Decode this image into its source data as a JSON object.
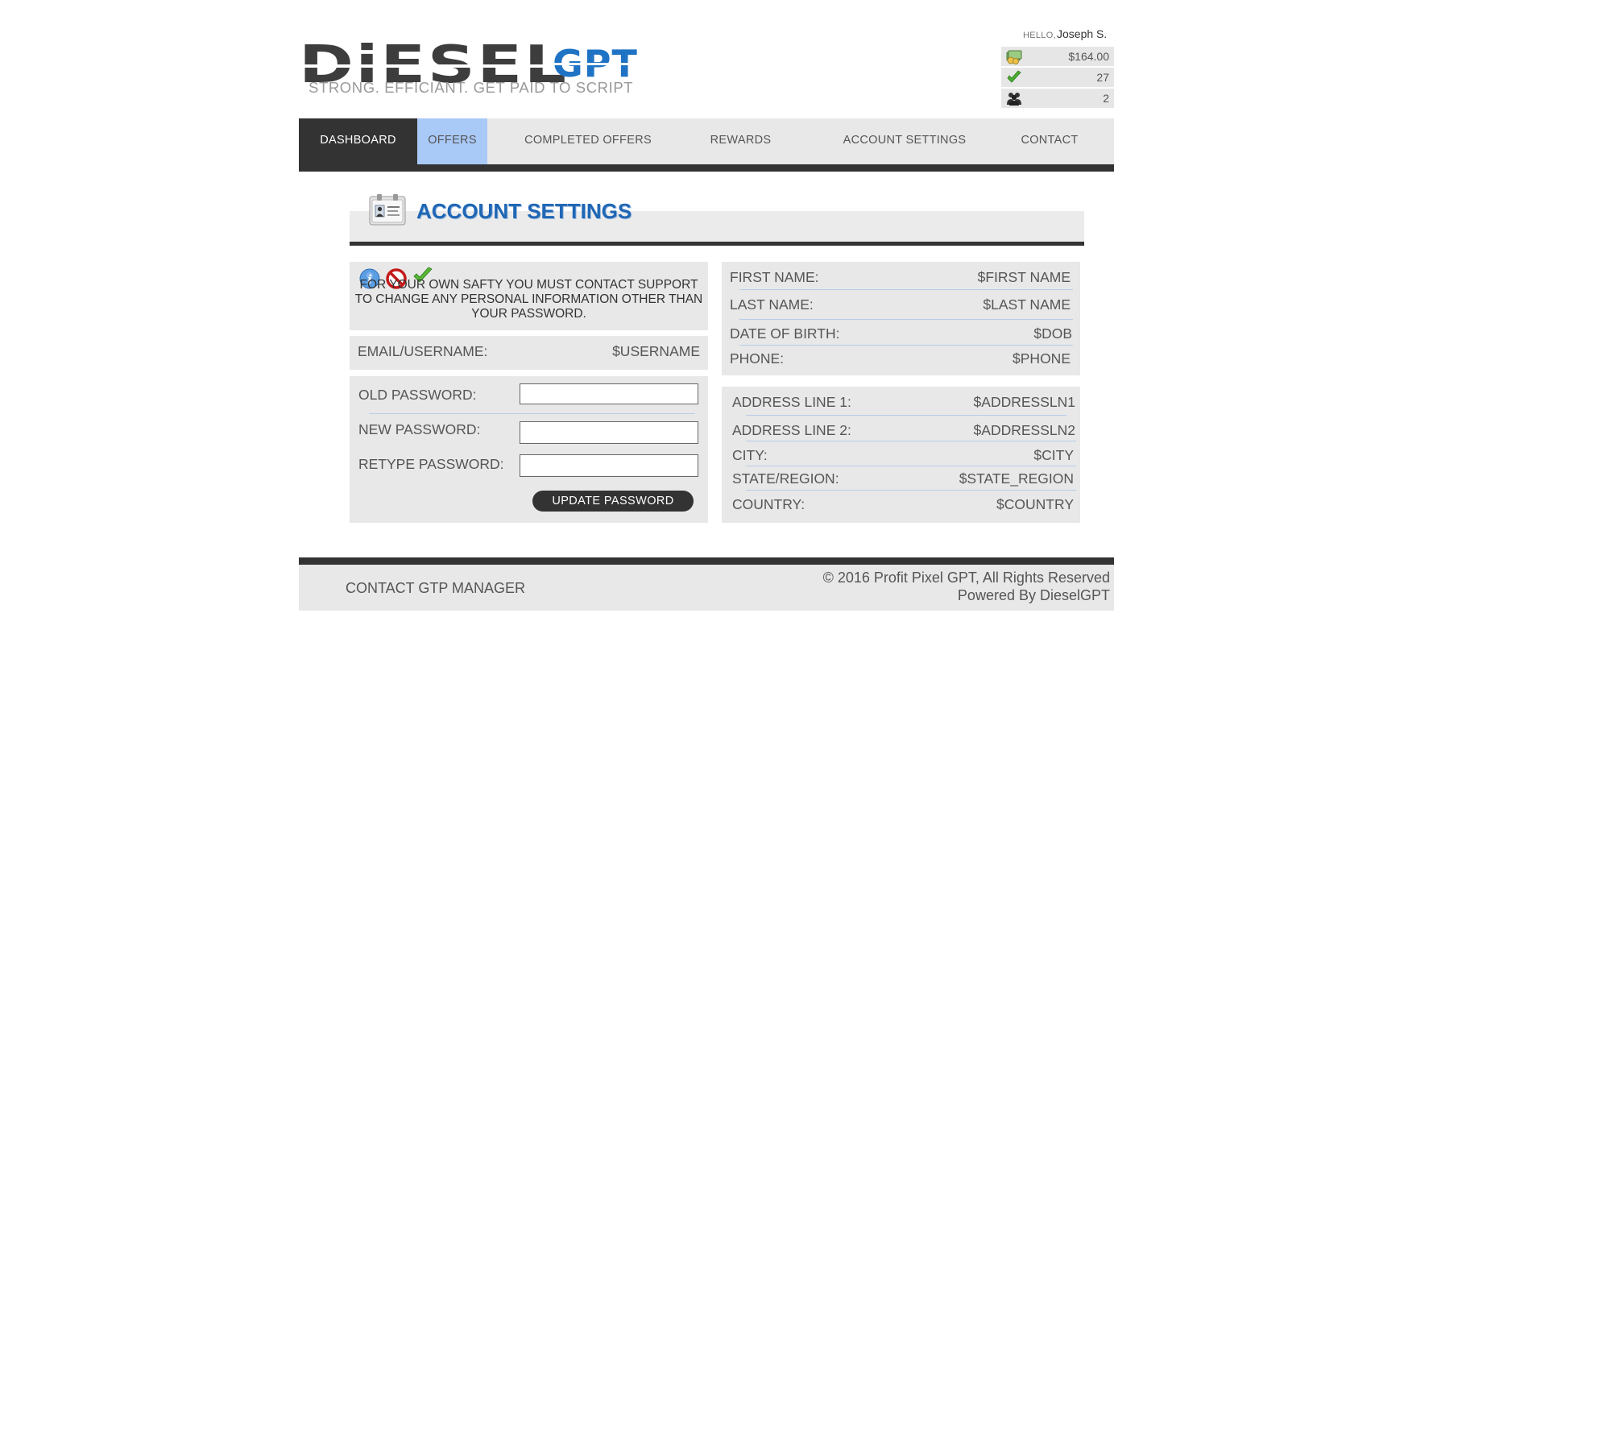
{
  "brand": {
    "logo_main": "DiESEL",
    "logo_accent": "GPT",
    "tagline": "STRONG. EFFICIANT. GET PAID TO SCRIPT"
  },
  "user": {
    "greeting": "HELLO,",
    "name": "Joseph S.",
    "balance": "$164.00",
    "completed_count": "27",
    "referrals": "2"
  },
  "nav": {
    "items": [
      {
        "label": "DASHBOARD"
      },
      {
        "label": "OFFERS"
      },
      {
        "label": "COMPLETED OFFERS"
      },
      {
        "label": "REWARDS"
      },
      {
        "label": "ACCOUNT SETTINGS"
      },
      {
        "label": "CONTACT"
      }
    ]
  },
  "section": {
    "title": "ACCOUNT SETTINGS"
  },
  "notice": {
    "text": "FOR YOUR OWN SAFTY YOU MUST CONTACT SUPPORT TO CHANGE ANY PERSONAL INFORMATION OTHER THAN YOUR PASSWORD."
  },
  "email": {
    "label": "EMAIL/USERNAME:",
    "value": "$USERNAME"
  },
  "password": {
    "old_label": "OLD PASSWORD:",
    "new_label": "NEW PASSWORD:",
    "retype_label": "RETYPE PASSWORD:",
    "old_value": "",
    "new_value": "",
    "retype_value": "",
    "update_button": "UPDATE PASSWORD"
  },
  "personal": {
    "rows": [
      {
        "label": "FIRST NAME:",
        "value": "$FIRST NAME"
      },
      {
        "label": "LAST NAME:",
        "value": "$LAST NAME"
      },
      {
        "label": "DATE OF BIRTH:",
        "value": "$DOB"
      },
      {
        "label": "PHONE:",
        "value": "$PHONE"
      }
    ]
  },
  "address": {
    "rows": [
      {
        "label": "ADDRESS LINE 1:",
        "value": "$ADDRESSLN1"
      },
      {
        "label": "ADDRESS LINE 2:",
        "value": "$ADDRESSLN2"
      },
      {
        "label": "CITY:",
        "value": "$CITY"
      },
      {
        "label": "STATE/REGION:",
        "value": "$STATE_REGION"
      },
      {
        "label": "COUNTRY:",
        "value": "$COUNTRY"
      }
    ]
  },
  "footer": {
    "contact": "CONTACT GTP MANAGER",
    "copyright": "© 2016 Profit Pixel GPT, All Rights Reserved",
    "powered": "Powered By DieselGPT"
  },
  "icons": {
    "balance": "money-icon",
    "completed": "checkmark-icon",
    "referrals": "users-icon",
    "section": "id-card-icon",
    "notice": [
      "info-icon",
      "prohibited-icon",
      "checkmark-icon"
    ]
  },
  "colors": {
    "brand_blue": "#1f66b5",
    "dark": "#333333",
    "panel": "#e8e8e8",
    "nav_hover": "#a9c9f7"
  }
}
